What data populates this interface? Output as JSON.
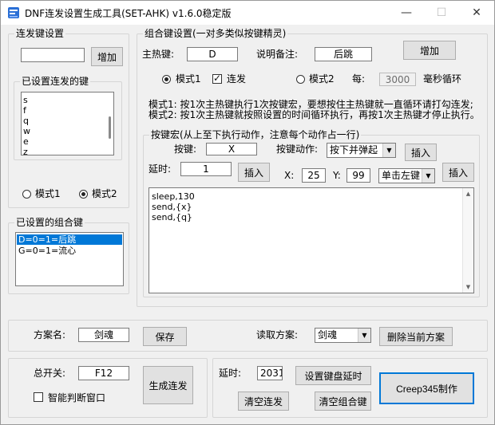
{
  "window": {
    "title": "DNF连发设置生成工具(SET-AHK) v1.6.0稳定版",
    "minimize": "—",
    "maximize": "☐",
    "close": "✕"
  },
  "burst": {
    "group_title": "连发键设置",
    "input_value": "",
    "add_button": "增加",
    "keys_group_title": "已设置连发的键",
    "keys": [
      "s",
      "f",
      "q",
      "w",
      "e",
      "z"
    ],
    "mode1_label": "模式1",
    "mode2_label": "模式2",
    "mode_selected": "模式2"
  },
  "combo_list": {
    "group_title": "已设置的组合键",
    "items": [
      "D=0=1=后跳",
      "G=0=1=流心"
    ],
    "selected_index": 0
  },
  "combo": {
    "group_title": "组合键设置(一对多类似按键精灵)",
    "hotkey_label": "主热键:",
    "hotkey_value": "D",
    "note_label": "说明备注:",
    "note_value": "后跳",
    "add_button": "增加",
    "mode1_label": "模式1",
    "burst_label": "连发",
    "burst_checked": true,
    "mode2_label": "模式2",
    "every_label": "每:",
    "every_value": "3000",
    "ms_label": "毫秒循环",
    "mode_selected": "模式1",
    "desc1": "模式1: 按1次主热键执行1次按键宏，要想按住主热键就一直循环请打勾连发;",
    "desc2": "模式2: 按1次主热键就按照设置的时间循环执行，再按1次主热键才停止执行。"
  },
  "macro": {
    "group_title": "按键宏(从上至下执行动作，注意每个动作占一行)",
    "key_label": "按键:",
    "key_value": "X",
    "action_label": "按键动作:",
    "action_value": "按下并弹起",
    "insert1": "插入",
    "delay_label": "延时:",
    "delay_value": "1",
    "insert2": "插入",
    "x_label": "X:",
    "x_value": "25",
    "y_label": "Y:",
    "y_value": "99",
    "click_value": "单击左键",
    "insert3": "插入",
    "lines": [
      "sleep,130",
      "send,{x}",
      "send,{q}"
    ]
  },
  "scheme": {
    "name_label": "方案名:",
    "name_value": "剑魂",
    "save_button": "保存",
    "load_label": "读取方案:",
    "load_value": "剑魂",
    "delete_button": "删除当前方案"
  },
  "bottom_left": {
    "switch_label": "总开关:",
    "switch_value": "F12",
    "smart_label": "智能判断窗口",
    "smart_checked": false,
    "generate_button": "生成连发"
  },
  "bottom_right": {
    "delay_label": "延时:",
    "delay_value": "2031",
    "set_delay_button": "设置键盘延时",
    "clear_burst_button": "清空连发",
    "clear_combo_button": "清空组合键",
    "credit_button": "Creep345制作"
  },
  "colors": {
    "selection": "#0078d7",
    "face": "#f0f0f0"
  }
}
